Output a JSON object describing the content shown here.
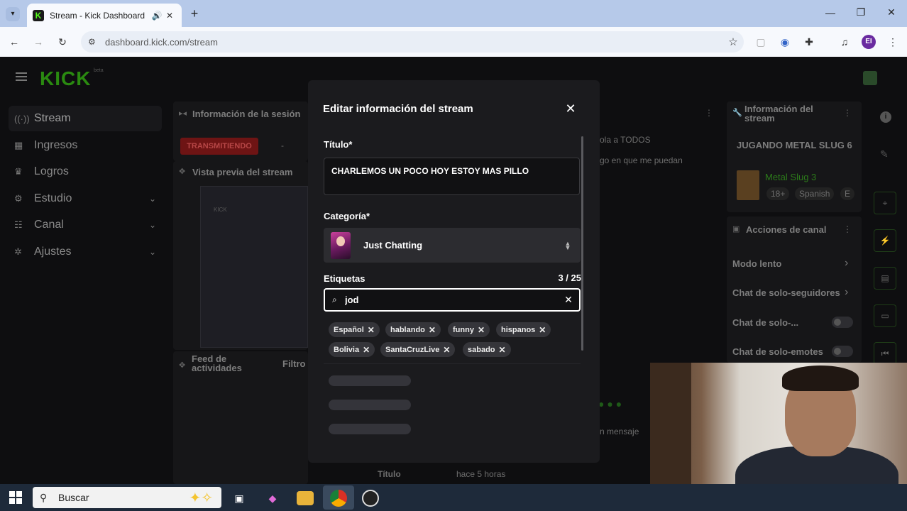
{
  "browser": {
    "tab_title": "Stream - Kick Dashboard",
    "tab_favicon": "K",
    "new_tab": "+",
    "url": "dashboard.kick.com/stream",
    "profile_initials": "EI"
  },
  "dashboard": {
    "logo": "KICK",
    "logo_badge": "beta",
    "sidebar": [
      {
        "label": "Stream",
        "icon": "broadcast-icon",
        "glyph": "((·))"
      },
      {
        "label": "Ingresos",
        "icon": "money-icon",
        "glyph": "▦"
      },
      {
        "label": "Logros",
        "icon": "trophy-icon",
        "glyph": "♛"
      },
      {
        "label": "Estudio",
        "icon": "studio-icon",
        "glyph": "⚙"
      },
      {
        "label": "Canal",
        "icon": "users-icon",
        "glyph": "☷"
      },
      {
        "label": "Ajustes",
        "icon": "gear-icon",
        "glyph": "✲"
      }
    ],
    "session_panel_title": "Información de la sesión",
    "live_badge": "TRANSMITIENDO",
    "live_dash": "-",
    "preview_panel_title": "Vista previa del stream",
    "preview_brand": "KICK",
    "feed_panel_title": "Feed de actividades",
    "feed_filter": "Filtro",
    "chat_line_1": "ola a TODOS",
    "chat_line_2": "go en que me puedan",
    "chat_input_placeholder": "n mensaje",
    "bottom_title_label": "Título",
    "bottom_time": "hace 5 horas",
    "stream_info_panel_title": "Información del stream",
    "stream_info_title": "JUGANDO METAL SLUG 6",
    "stream_info_game": "Metal Slug 3",
    "stream_info_tags": [
      "18+",
      "Spanish",
      "E"
    ],
    "channel_actions_title": "Acciones de canal",
    "channel_actions": [
      "Modo lento",
      "Chat de solo-seguidores",
      "Chat de solo-...",
      "Chat de solo-emotes"
    ]
  },
  "modal": {
    "title": "Editar información del stream",
    "title_label": "Título*",
    "title_value": "CHARLEMOS UN POCO HOY ESTOY MAS PILLO",
    "category_label": "Categoría*",
    "category_value": "Just Chatting",
    "tags_label": "Etiquetas",
    "tags_count": "3 / 25",
    "tag_search_value": "jod",
    "tags": [
      "Español",
      "hablando",
      "funny",
      "hispanos",
      "Bolivia",
      "SantaCruzLive",
      "sabado"
    ]
  },
  "taskbar": {
    "search_label": "Buscar"
  },
  "colors": {
    "kick_green": "#53fc18",
    "modal_bg": "#1b1b1e",
    "live_red": "#6e1414"
  }
}
